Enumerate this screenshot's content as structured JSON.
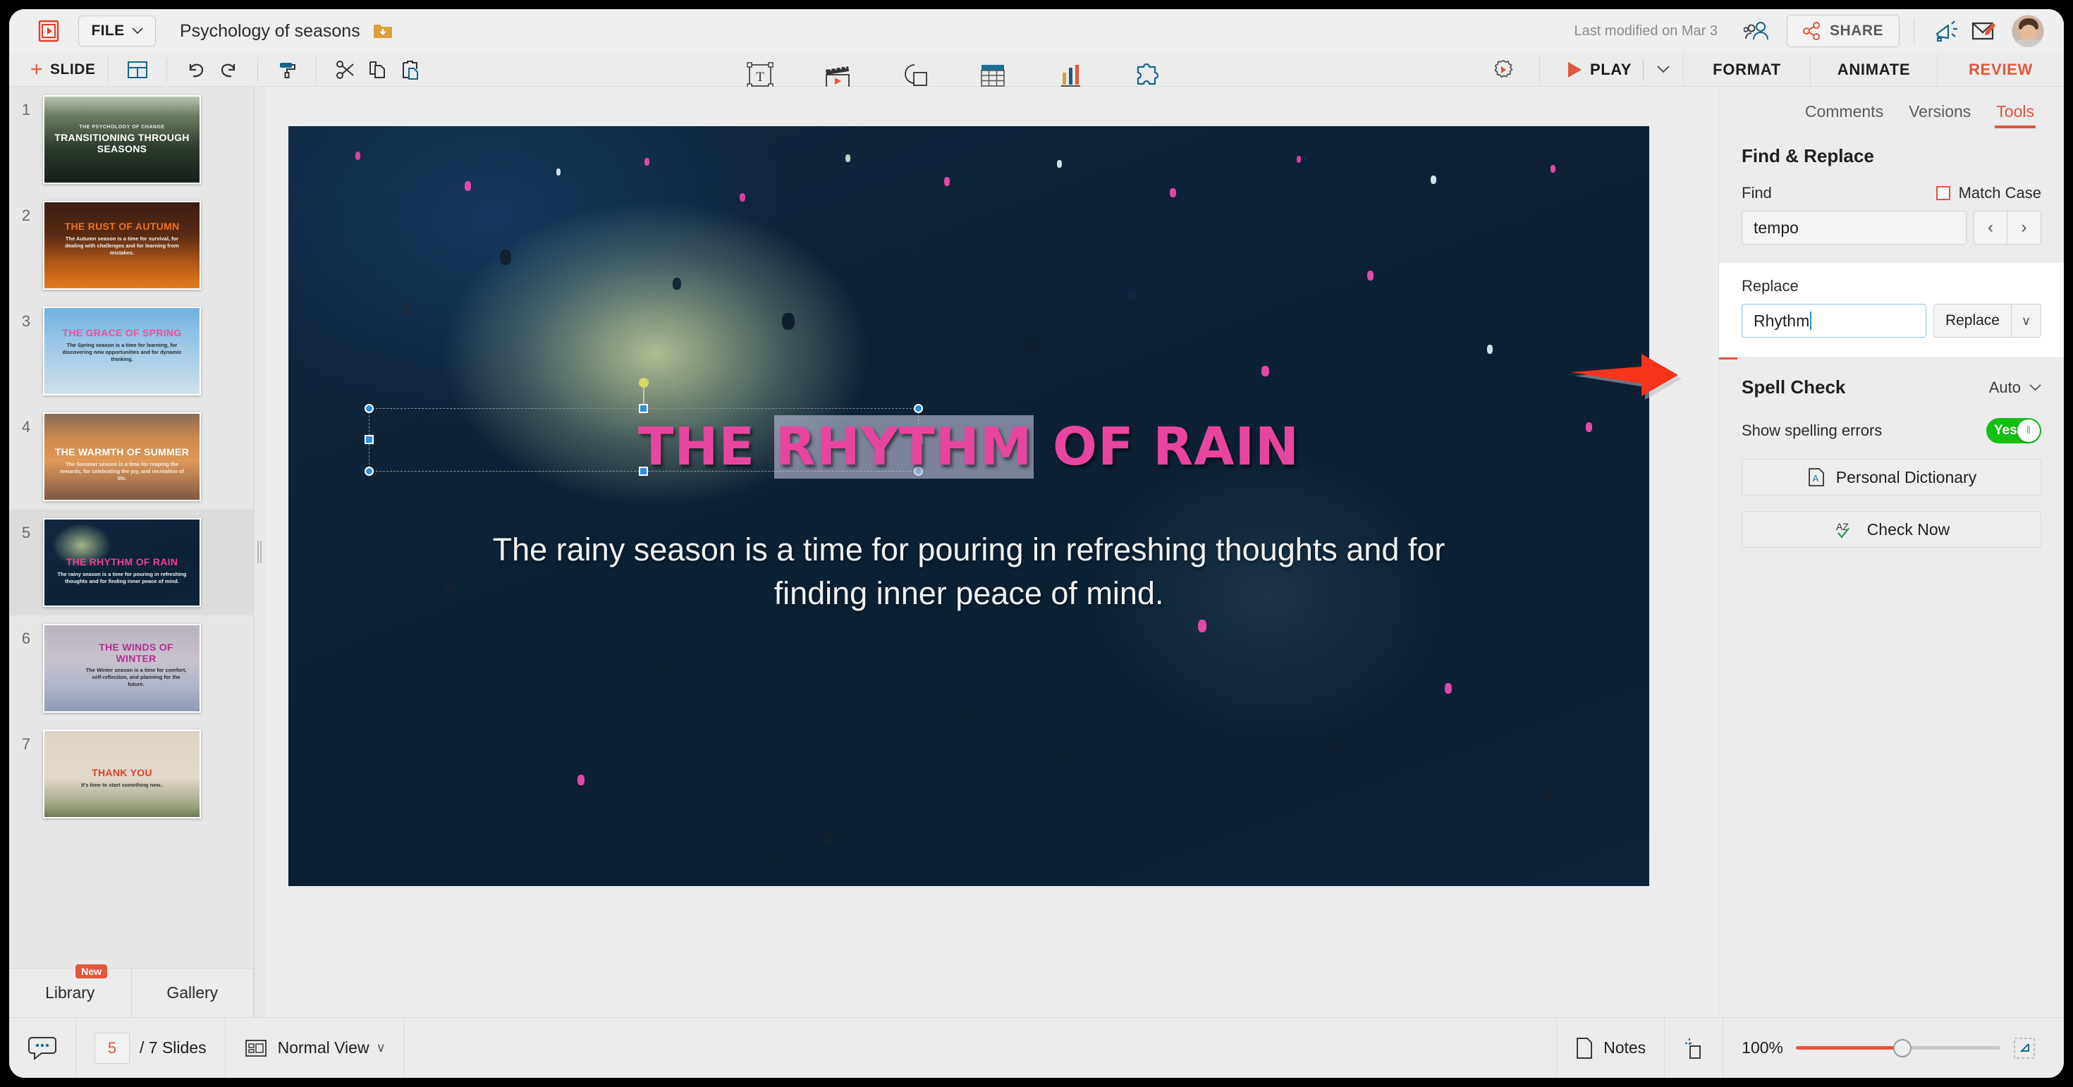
{
  "app": {
    "file_menu": "FILE",
    "document_title": "Psychology of seasons",
    "last_modified": "Last modified on Mar 3",
    "share_label": "SHARE",
    "new_slide_label": "SLIDE",
    "play_label": "PLAY"
  },
  "insert_tools": [
    {
      "label": "Text",
      "icon": "text-box-icon"
    },
    {
      "label": "Media",
      "icon": "clapperboard-icon"
    },
    {
      "label": "Shape",
      "icon": "shape-icon"
    },
    {
      "label": "Table",
      "icon": "table-icon"
    },
    {
      "label": "Chart",
      "icon": "bar-chart-icon"
    },
    {
      "label": "Add-Ons",
      "icon": "puzzle-piece-icon"
    }
  ],
  "ribbon_tabs": [
    {
      "label": "FORMAT",
      "active": false
    },
    {
      "label": "ANIMATE",
      "active": false
    },
    {
      "label": "REVIEW",
      "active": true
    }
  ],
  "sidebar": {
    "slides": [
      {
        "num": "1",
        "eyebrow": "THE PSYCHOLOGY OF CHANGE",
        "title": "TRANSITIONING THROUGH SEASONS",
        "body": ""
      },
      {
        "num": "2",
        "eyebrow": "",
        "title": "THE RUST OF AUTUMN",
        "body": "The Autumn season is a time for survival, for dealing with challenges and for learning from mistakes."
      },
      {
        "num": "3",
        "eyebrow": "",
        "title": "THE GRACE OF SPRING",
        "body": "The Spring season is a time for learning, for discovering new opportunities and for dynamic thinking."
      },
      {
        "num": "4",
        "eyebrow": "",
        "title": "THE WARMTH OF SUMMER",
        "body": "The Summer season is a time for reaping the rewards, for celebrating the joy, and recreation of life."
      },
      {
        "num": "5",
        "eyebrow": "",
        "title": "THE RHYTHM OF RAIN",
        "body": "The rainy season is a time for pouring in refreshing thoughts and for finding inner peace of mind."
      },
      {
        "num": "6",
        "eyebrow": "",
        "title": "THE WINDS OF WINTER",
        "body": "The Winter season is a time for comfort, self-reflection, and planning for the future."
      },
      {
        "num": "7",
        "eyebrow": "",
        "title": "THANK YOU",
        "body": "It's time to start something new.."
      }
    ],
    "library_tab": "Library",
    "library_badge": "New",
    "gallery_tab": "Gallery"
  },
  "slide_canvas": {
    "title_prefix": "THE ",
    "title_highlight": "RHYTHM",
    "title_suffix": " OF RAIN",
    "body": "The rainy season is a time for pouring in refreshing thoughts and for finding inner peace of mind."
  },
  "right_panel": {
    "tabs": [
      {
        "label": "Comments",
        "active": false
      },
      {
        "label": "Versions",
        "active": false
      },
      {
        "label": "Tools",
        "active": true
      }
    ],
    "find_replace": {
      "section_title": "Find & Replace",
      "find_label": "Find",
      "match_case_label": "Match Case",
      "match_case_checked": false,
      "find_value": "tempo",
      "find_placeholder": "Find",
      "prev_glyph": "‹",
      "next_glyph": "›",
      "replace_label": "Replace",
      "replace_value": "Rhythm",
      "replace_placeholder": "Replace",
      "replace_button": "Replace",
      "replace_menu_glyph": "∨"
    },
    "spell_check": {
      "section_title": "Spell Check",
      "mode": "Auto",
      "mode_glyph": "∨",
      "show_errors_label": "Show spelling errors",
      "toggle_value": "Yes",
      "personal_dictionary": "Personal Dictionary",
      "check_now": "Check Now"
    }
  },
  "status_bar": {
    "current_slide": "5",
    "slide_count": "/ 7 Slides",
    "view_mode": "Normal View",
    "view_caret": "∨",
    "notes_label": "Notes",
    "zoom_level": "100%"
  },
  "colors": {
    "accent": "#e2563d",
    "title_pink": "#e8469e",
    "toggle_green": "#14c014",
    "selection_blue": "#2d8fe0",
    "annotation_red": "#f5341a"
  }
}
